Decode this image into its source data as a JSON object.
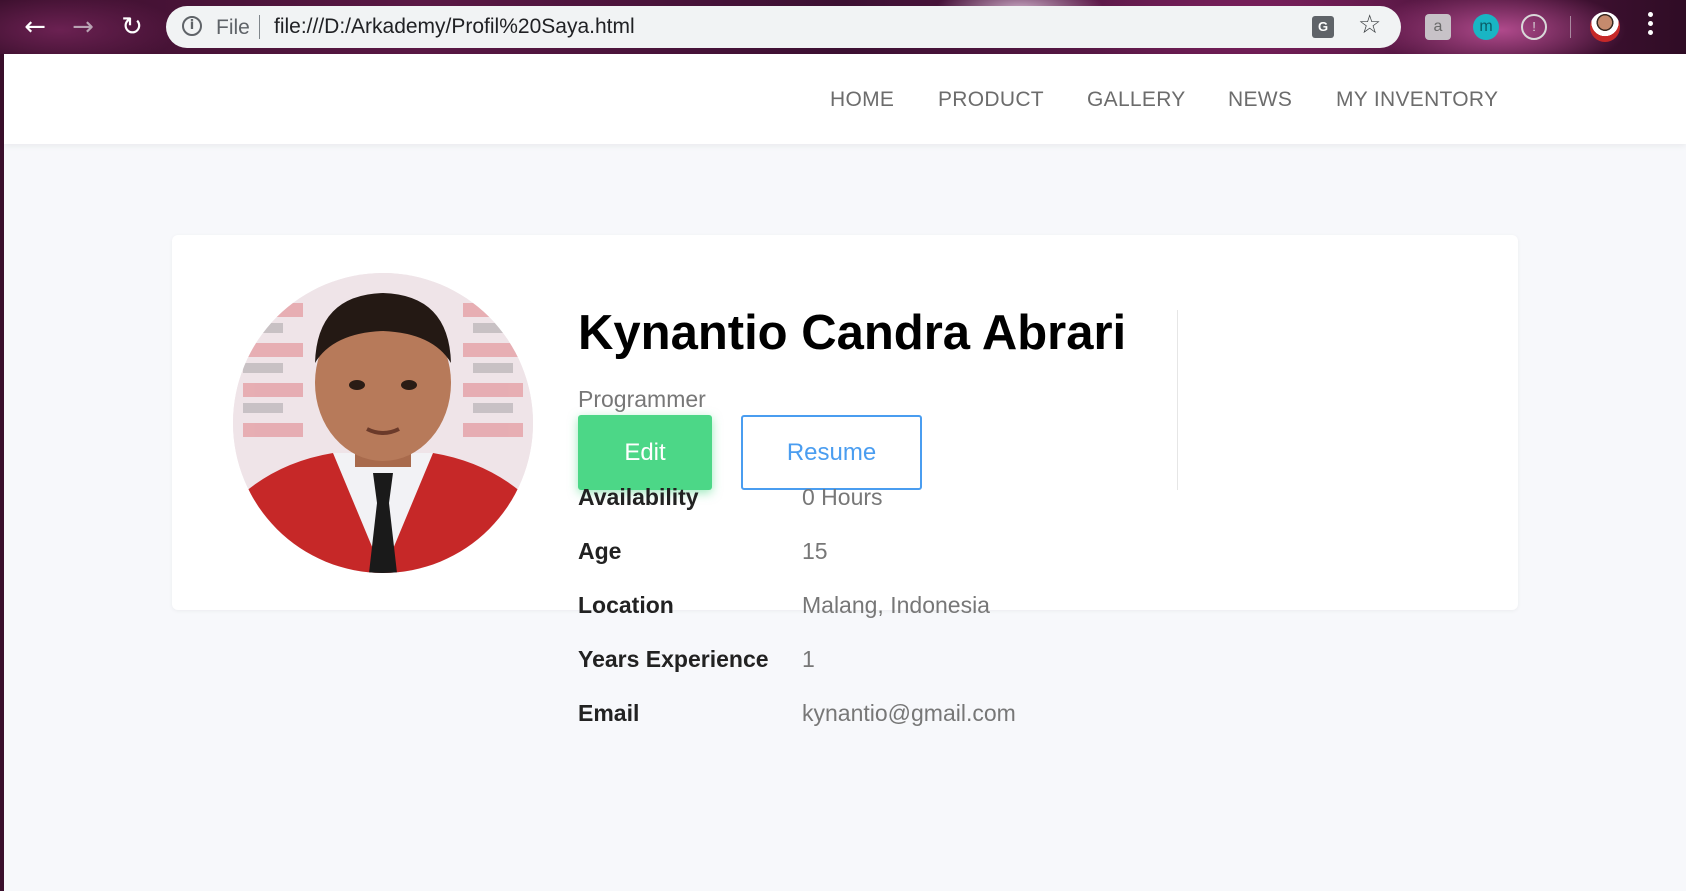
{
  "browser": {
    "scheme_label": "File",
    "url": "file:///D:/Arkademy/Profil%20Saya.html",
    "icons": [
      "back-arrow-icon",
      "forward-arrow-icon",
      "reload-icon",
      "info-icon",
      "translate-icon",
      "star-icon",
      "shopping-bag-icon",
      "m-extension-icon",
      "lightbulb-icon",
      "profile-avatar",
      "menu-icon"
    ]
  },
  "navbar": {
    "links": [
      "HOME",
      "PRODUCT",
      "GALLERY",
      "NEWS",
      "MY INVENTORY"
    ]
  },
  "profile": {
    "name": "Kynantio Candra Abrari",
    "role": "Programmer",
    "edit_label": "Edit",
    "resume_label": "Resume",
    "details": [
      {
        "label": "Availability",
        "value": "0 Hours"
      },
      {
        "label": "Age",
        "value": "15"
      },
      {
        "label": "Location",
        "value": "Malang, Indonesia"
      },
      {
        "label": "Years Experience",
        "value": "1"
      },
      {
        "label": "Email",
        "value": "kynantio@gmail.com"
      }
    ]
  },
  "colors": {
    "edit_button": "#4cd787",
    "resume_border": "#4a9df0",
    "page_background": "#f7f8fb"
  }
}
